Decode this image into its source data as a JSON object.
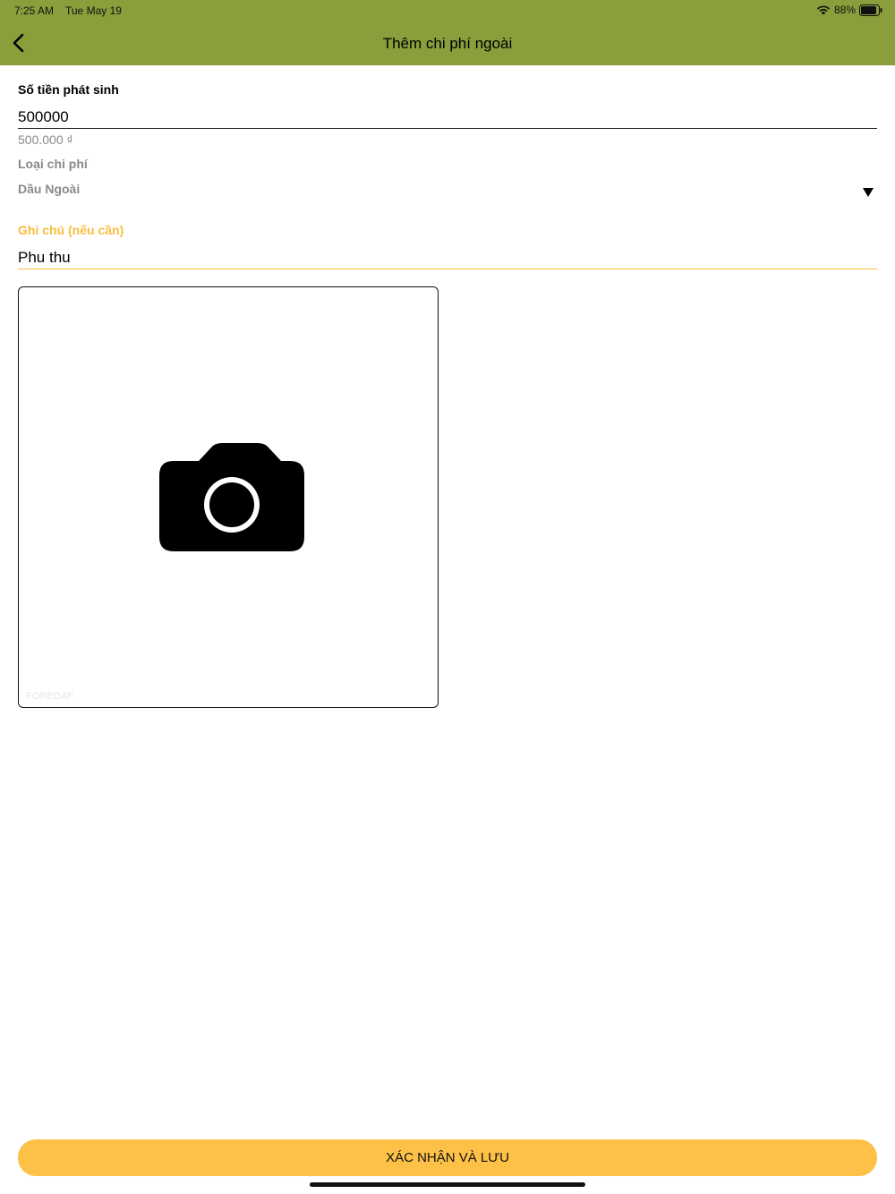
{
  "status_bar": {
    "time": "7:25 AM",
    "date": "Tue May 19",
    "battery": "88%"
  },
  "nav": {
    "title": "Thêm chi phí ngoài",
    "back_icon": "chevron-left-icon"
  },
  "form": {
    "amount": {
      "label": "Số tiền phát sinh",
      "value": "500000",
      "formatted": "500.000 ₫"
    },
    "expense_type": {
      "label": "Loại chi phí",
      "selected": "Dầu Ngoài",
      "icon": "triangle-down-icon"
    },
    "note": {
      "label": "Ghi chú (nếu cần)",
      "value": "Phu thu"
    },
    "photo": {
      "icon": "camera-icon",
      "watermark": "FOREOAF"
    }
  },
  "confirm_button": {
    "label": "XÁC NHẬN VÀ LƯU"
  },
  "colors": {
    "header_bg": "#8a9e3c",
    "accent": "#f9bd3c",
    "button_bg": "#fdc148",
    "muted_text": "#8a8a8a"
  }
}
